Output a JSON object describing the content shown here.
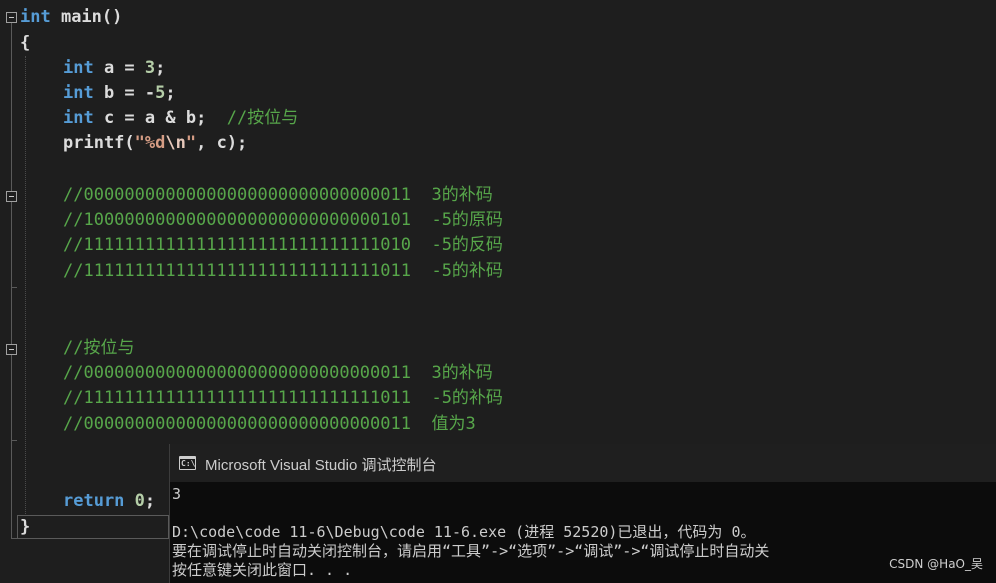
{
  "editor": {
    "lines": [
      {
        "t_kw": "int",
        "t_rest": " main()"
      },
      {
        "text": "{"
      },
      {
        "kw": "int",
        "mid": " a = ",
        "num": "3",
        "end": ";"
      },
      {
        "kw": "int",
        "mid": " b = -",
        "num": "5",
        "end": ";"
      },
      {
        "kw": "int",
        "mid": " c = a & b;  ",
        "comment": "//按位与"
      },
      {
        "pre": "printf(",
        "str1": "\"%d",
        "esc": "\\n",
        "str2": "\"",
        "post": ", c);"
      },
      {
        "comment": "//00000000000000000000000000000011  3的补码"
      },
      {
        "comment": "//10000000000000000000000000000101  -5的原码"
      },
      {
        "comment": "//11111111111111111111111111111010  -5的反码"
      },
      {
        "comment": "//11111111111111111111111111111011  -5的补码"
      },
      {
        "comment": "//按位与"
      },
      {
        "comment": "//00000000000000000000000000000011  3的补码"
      },
      {
        "comment": "//11111111111111111111111111111011  -5的补码"
      },
      {
        "comment": "//00000000000000000000000000000011  值为3"
      },
      {
        "kw": "return",
        "mid": " ",
        "num": "0",
        "end": ";"
      },
      {
        "text": "}"
      }
    ]
  },
  "console": {
    "icon_text": "C:\\",
    "title": "Microsoft Visual Studio 调试控制台",
    "output": [
      "3",
      "",
      "D:\\code\\code 11-6\\Debug\\code 11-6.exe (进程 52520)已退出，代码为 0。",
      "要在调试停止时自动关闭控制台，请启用“工具”->“选项”->“调试”->“调试停止时自动关",
      "按任意键关闭此窗口. . ."
    ]
  },
  "watermark": "CSDN @HaO_吴",
  "colors": {
    "background": "#1e1e1e",
    "keyword": "#569cd6",
    "comment": "#57a64a",
    "number": "#b5cea8",
    "string": "#d69d85",
    "console_bg": "#0c0c0c"
  }
}
